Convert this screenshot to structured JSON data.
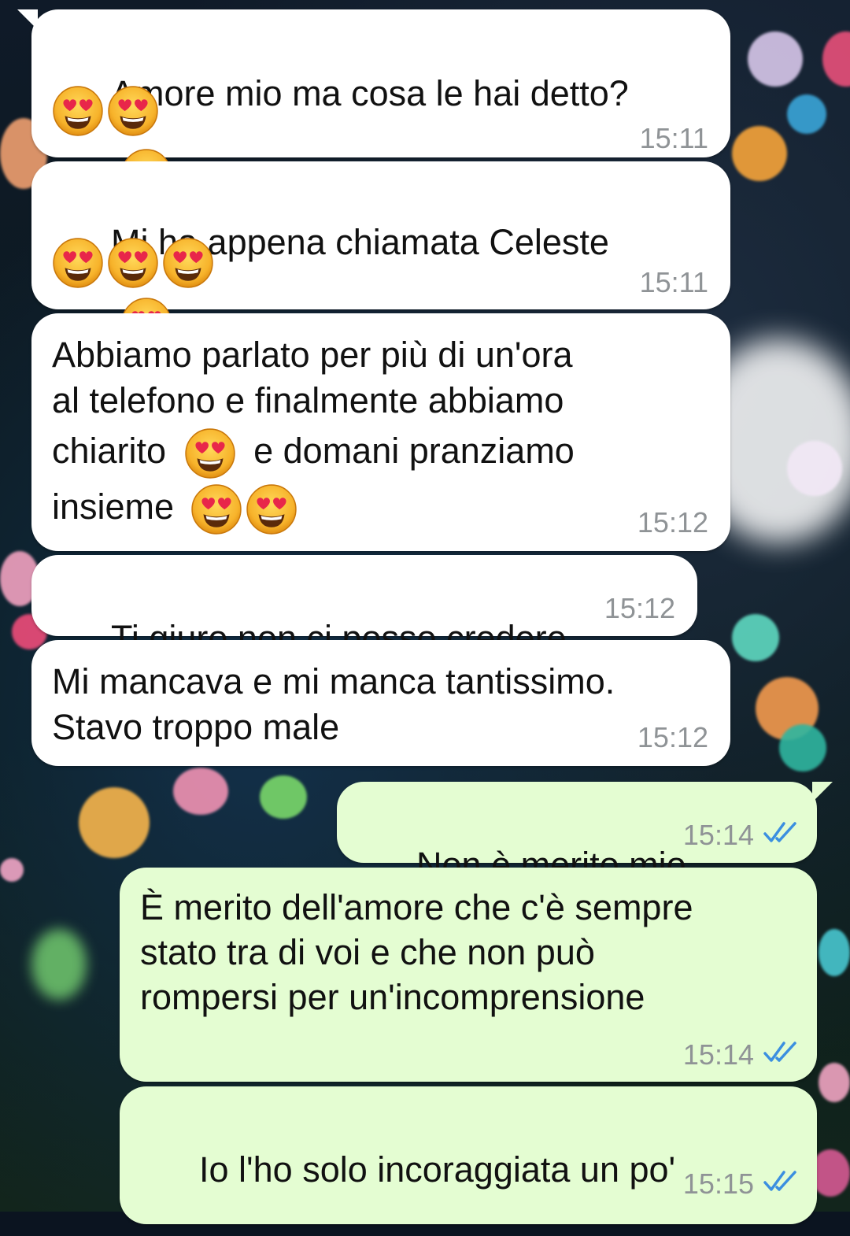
{
  "colors": {
    "incoming_bubble": "#ffffff",
    "outgoing_bubble": "#e4fdd2",
    "timestamp": "#8f9396",
    "read_ticks": "#3b8fe0"
  },
  "messages": [
    {
      "direction": "incoming",
      "lines": [
        "Amore mio ma cosa le hai detto?"
      ],
      "emoji": "heart-eyes-emoji",
      "time": "15:11"
    },
    {
      "direction": "incoming",
      "lines": [
        "Mi ha appena chiamata Celeste"
      ],
      "emoji": "heart-eyes-emoji",
      "time": "15:11"
    },
    {
      "direction": "incoming",
      "lines": [
        "Abbiamo parlato per più di un'ora",
        "al telefono e finalmente abbiamo",
        "chiarito",
        "e domani pranziamo",
        "insieme"
      ],
      "emoji": "heart-eyes-emoji",
      "time": "15:12"
    },
    {
      "direction": "incoming",
      "lines": [
        "Ti giuro non ci posso credere"
      ],
      "time": "15:12"
    },
    {
      "direction": "incoming",
      "lines": [
        "Mi mancava e mi manca tantissimo.",
        "Stavo troppo male"
      ],
      "time": "15:12"
    },
    {
      "direction": "outgoing",
      "lines": [
        "Non è merito mio"
      ],
      "time": "15:14",
      "status": "read"
    },
    {
      "direction": "outgoing",
      "lines": [
        "È merito dell'amore che c'è sempre",
        "stato tra di voi e che non può",
        "rompersi per un'incomprensione"
      ],
      "time": "15:14",
      "status": "read"
    },
    {
      "direction": "outgoing",
      "lines": [
        "Io l'ho solo incoraggiata un po'"
      ],
      "time": "15:15",
      "status": "read"
    }
  ]
}
